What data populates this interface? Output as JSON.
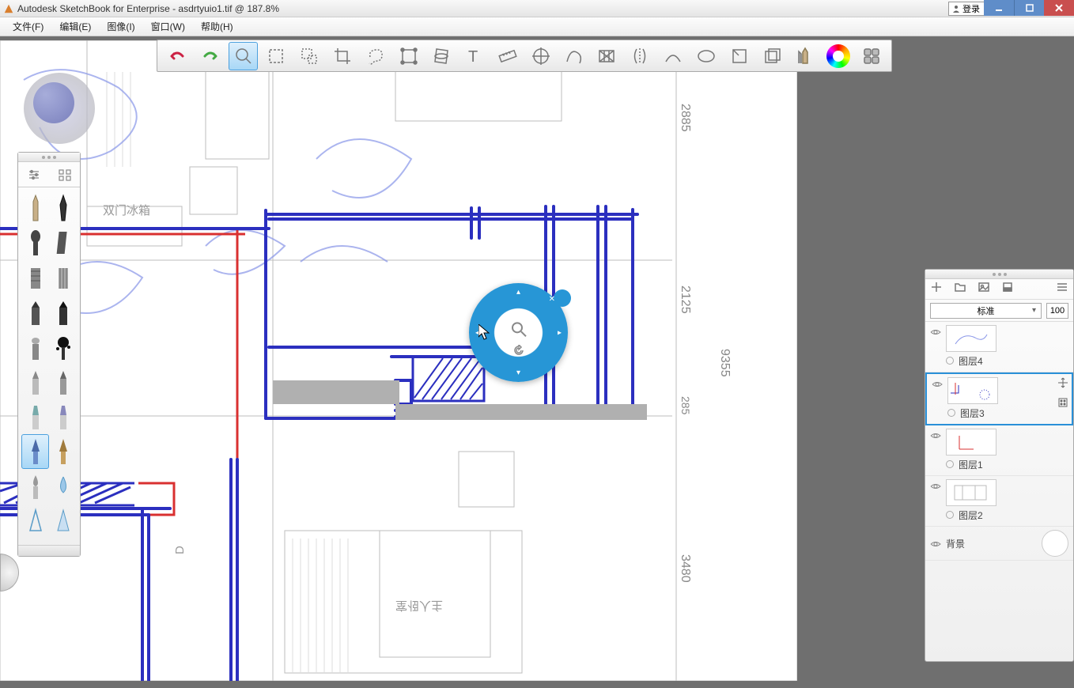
{
  "title_bar": {
    "title": "Autodesk SketchBook for Enterprise - asdrtyuio1.tif @ 187.8%",
    "login_label": "登录"
  },
  "menu": {
    "file": "文件(F)",
    "edit": "编辑(E)",
    "image": "图像(I)",
    "window": "窗口(W)",
    "help": "帮助(H)"
  },
  "toolbar_icons": [
    "undo",
    "redo",
    "zoom",
    "marquee",
    "lasso-add",
    "crop",
    "fill-region",
    "transform",
    "distort",
    "text",
    "ruler",
    "ellipse-guide",
    "french-curve",
    "perspective",
    "symmetry",
    "stroke-stabilizer",
    "shape-ellipse",
    "predictive-stroke",
    "copy-stack",
    "brush-set",
    "color-wheel",
    "lagoon"
  ],
  "active_tool": "zoom",
  "brush_palette": {
    "active_index": 16
  },
  "layers_panel": {
    "blend_mode": "标准",
    "opacity": "100",
    "layers": [
      {
        "name": "图层4",
        "selected": false
      },
      {
        "name": "图层3",
        "selected": true
      },
      {
        "name": "图层1",
        "selected": false
      },
      {
        "name": "图层2",
        "selected": false
      }
    ],
    "background_label": "背景"
  },
  "canvas_labels": {
    "dim1": "2885",
    "dim2": "2125",
    "dim3": "9355",
    "dim4": "285",
    "dim5": "3480",
    "fridge": "双门冰箱"
  }
}
